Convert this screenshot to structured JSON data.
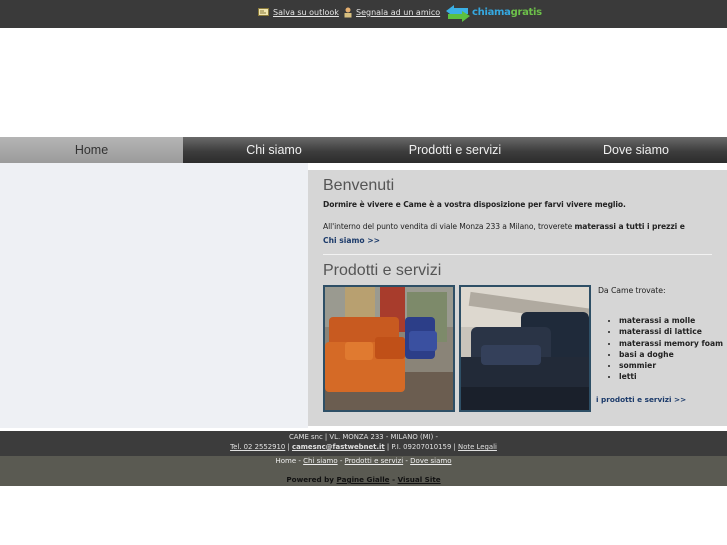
{
  "topbar": {
    "outlook_label": "Salva su outlook",
    "friend_label": "Segnala ad un amico",
    "logo_part1": "chiama",
    "logo_part2": "gratis"
  },
  "nav": {
    "items": [
      {
        "label": "Home"
      },
      {
        "label": "Chi siamo"
      },
      {
        "label": "Prodotti e servizi"
      },
      {
        "label": "Dove siamo"
      }
    ]
  },
  "welcome": {
    "title": "Benvenuti",
    "intro": "Dormire è vivere e Came è a vostra disposizione per farvi vivere meglio.",
    "body_prefix": "All'interno del punto vendita di viale Monza 233 a Milano, troverete",
    "body_bold": "materassi a tutti i prezzi e",
    "more_link": "Chi siamo >>"
  },
  "products": {
    "title": "Prodotti e servizi",
    "trovate_label": "Da Came trovate:",
    "items": [
      {
        "label": "materassi a molle"
      },
      {
        "label": "materassi di lattice"
      },
      {
        "label": "materassi memory foam"
      },
      {
        "label": "basi a doghe"
      },
      {
        "label": "sommier"
      },
      {
        "label": "letti"
      }
    ],
    "more_link": "i prodotti e servizi >>"
  },
  "footer": {
    "company": "CAME snc | VL. MONZA 233 - MILANO (MI) -",
    "phone": "Tel. 02 2552910",
    "email": "camesnc@fastwebnet.it",
    "vat": "P.I. 09207010159",
    "legal": "Note Legali",
    "nav_home": "Home",
    "nav_chi": "Chi siamo",
    "nav_prodotti": "Prodotti e servizi",
    "nav_dove": "Dove siamo",
    "powered_label": "Powered by",
    "powered_1": "Pagine Gialle",
    "powered_2": "Visual Site"
  },
  "colors": {
    "topbar": "#3a3a3a",
    "nav_active": "#a9a9a9",
    "content_bg": "#d6d6d6",
    "link": "#1b3a6a"
  }
}
